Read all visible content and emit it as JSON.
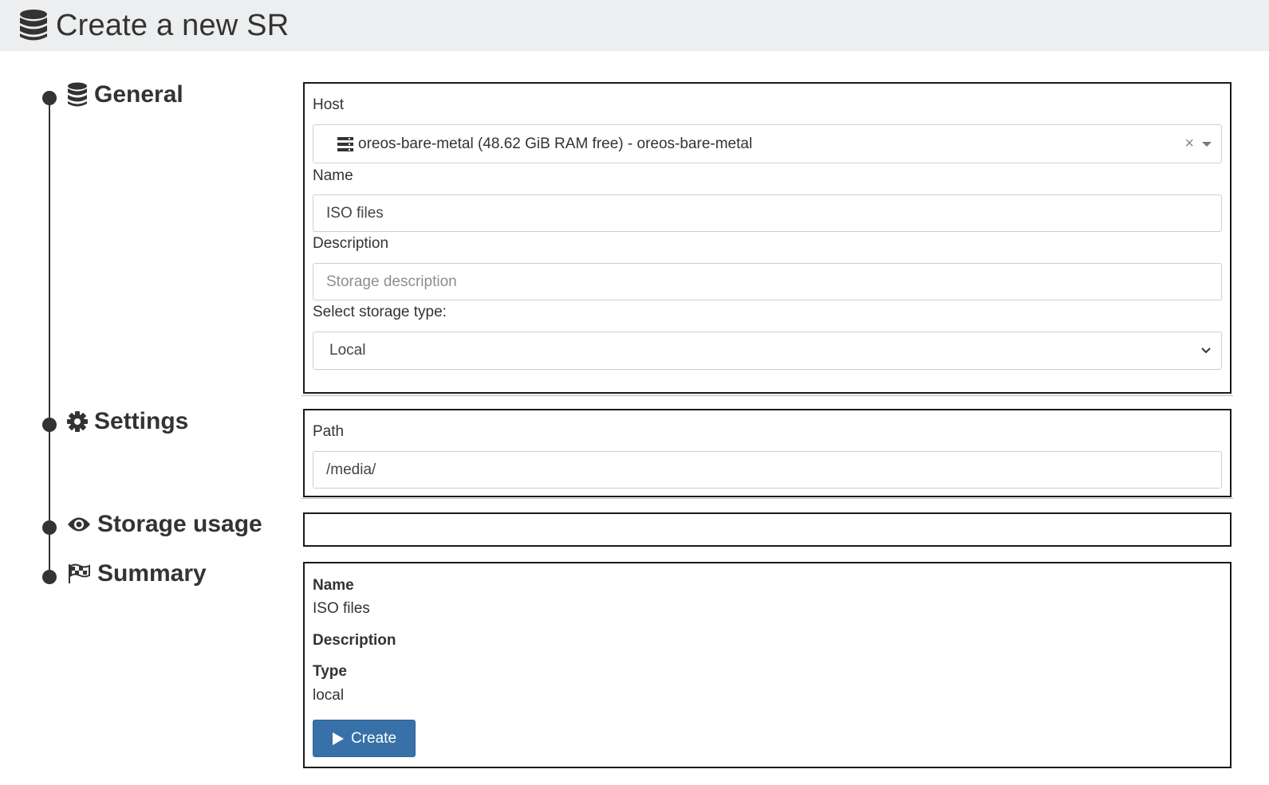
{
  "header": {
    "title": "Create a new SR",
    "icon": "database-icon"
  },
  "steps": [
    {
      "label": "General",
      "icon": "database-icon"
    },
    {
      "label": "Settings",
      "icon": "gear-icon"
    },
    {
      "label": "Storage usage",
      "icon": "eye-icon"
    },
    {
      "label": "Summary",
      "icon": "flag-checkered-icon"
    }
  ],
  "general": {
    "host_label": "Host",
    "host_value": "oreos-bare-metal (48.62 GiB RAM free) - oreos-bare-metal",
    "host_clear": "×",
    "name_label": "Name",
    "name_value": "ISO files",
    "description_label": "Description",
    "description_placeholder": "Storage description",
    "type_label": "Select storage type:",
    "type_value": "Local"
  },
  "settings": {
    "path_label": "Path",
    "path_value": "/media/"
  },
  "summary": {
    "name_label": "Name",
    "name_value": "ISO files",
    "description_label": "Description",
    "type_label": "Type",
    "type_value": "local",
    "create_label": "Create"
  },
  "colors": {
    "primary_button": "#3871a8",
    "header_bg": "#eceeef",
    "text": "#333333"
  }
}
